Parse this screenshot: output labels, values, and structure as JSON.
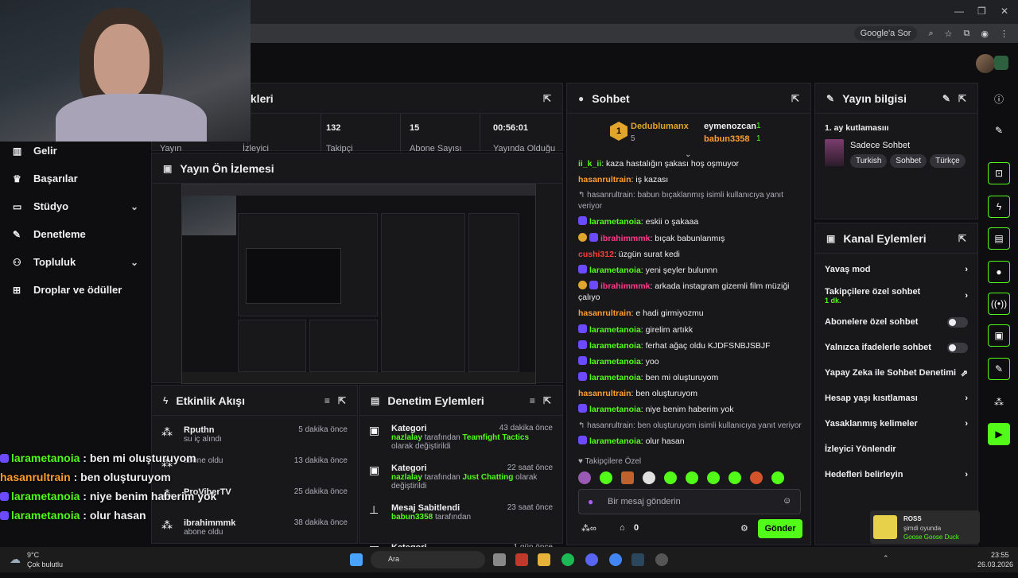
{
  "browser": {
    "search_pill": "Google'a Sor"
  },
  "nav": {
    "items": [
      {
        "label": "Gelir",
        "icon": "chart-icon"
      },
      {
        "label": "Başarılar",
        "icon": "trophy-icon"
      },
      {
        "label": "Stüdyo",
        "icon": "studio-icon"
      },
      {
        "label": "Denetleme",
        "icon": "wrench-icon"
      },
      {
        "label": "Topluluk",
        "icon": "community-icon"
      },
      {
        "label": "Droplar ve ödüller",
        "icon": "gift-icon"
      }
    ]
  },
  "stats": {
    "title_fragment": "ikleri",
    "values": [
      "132",
      "15",
      "00:56:01"
    ],
    "labels": [
      "Yayın",
      "İzleyici",
      "Takipçi",
      "Abone Sayısı",
      "Yayında Olduğu"
    ]
  },
  "preview": {
    "title": "Yayın Ön İzlemesi"
  },
  "events": {
    "title": "Etkinlik Akışı",
    "items": [
      {
        "user": "Rputhn",
        "detail": "su iç alındı",
        "time": "5 dakika önce"
      },
      {
        "user": "",
        "detail": "abone oldu",
        "time": "13 dakika önce"
      },
      {
        "user": "ProViberTV",
        "detail": "",
        "time": "25 dakika önce"
      },
      {
        "user": "ibrahimmmk",
        "detail": "abone oldu",
        "time": "38 dakika önce"
      }
    ]
  },
  "moderation": {
    "title": "Denetim Eylemleri",
    "items": [
      {
        "title": "Kategori",
        "time": "43 dakika önce",
        "who": "nazlalay",
        "mid": " tarafından ",
        "what": "Teamfight Tactics",
        "end": " olarak değiştirildi"
      },
      {
        "title": "Kategori",
        "time": "22 saat önce",
        "who": "nazlalay",
        "mid": " tarafından ",
        "what": "Just Chatting",
        "end": " olarak değiştirildi"
      },
      {
        "title": "Mesaj Sabitlendi",
        "time": "23 saat önce",
        "who": "babun3358",
        "mid": " tarafından",
        "what": "",
        "end": ""
      },
      {
        "title": "Kategori",
        "time": "1 gün önce",
        "who": "",
        "mid": "",
        "what": "",
        "end": ""
      }
    ]
  },
  "chat": {
    "title": "Sohbet",
    "top": [
      {
        "name": "Dedublumanx",
        "count": "5"
      },
      {
        "name": "eymenozcan",
        "count": "1"
      },
      {
        "name": "babun3358",
        "count": "1"
      }
    ],
    "rank": "1",
    "messages": [
      {
        "user": "ii_k_ii",
        "text": ": kaza hastalığın şakası hoş oşmuyor",
        "color": "u-g",
        "badge": ""
      },
      {
        "user": "hasanrultrain",
        "text": ": iş kazası",
        "color": "u-o",
        "badge": ""
      },
      {
        "reply": "hasanrultrain: babun bıçaklanmış isimli kullanıcıya yanıt veriyor"
      },
      {
        "user": "larametanoia",
        "text": ": eskii o şakaaa",
        "color": "u-g",
        "badge": "p"
      },
      {
        "user": "ibrahimmmk",
        "text": ": bıçak babunlanmış",
        "color": "u-p",
        "badge": "gp"
      },
      {
        "user": "cushi312",
        "text": ": üzgün surat kedi",
        "color": "u-r",
        "badge": ""
      },
      {
        "user": "larametanoia",
        "text": ": yeni şeyler bulunnn",
        "color": "u-g",
        "badge": "p"
      },
      {
        "user": "ibrahimmmk",
        "text": ": arkada instagram gizemli film müziği çalıyo",
        "color": "u-p",
        "badge": "gp"
      },
      {
        "user": "hasanrultrain",
        "text": ": e hadi girmiyozmu",
        "color": "u-o",
        "badge": ""
      },
      {
        "user": "larametanoia",
        "text": ": girelim artıkk",
        "color": "u-g",
        "badge": "p"
      },
      {
        "user": "larametanoia",
        "text": ": ferhat ağaç oldu KJDFSNBJSBJF",
        "color": "u-g",
        "badge": "p"
      },
      {
        "user": "larametanoia",
        "text": ": yoo",
        "color": "u-g",
        "badge": "p"
      },
      {
        "user": "larametanoia",
        "text": ": ben mi oluşturuyom",
        "color": "u-g",
        "badge": "p"
      },
      {
        "user": "hasanrultrain",
        "text": ": ben oluşturuyom",
        "color": "u-o",
        "badge": ""
      },
      {
        "user": "larametanoia",
        "text": ": niye benim haberim yok",
        "color": "u-g",
        "badge": "p"
      },
      {
        "reply": "hasanrultrain: ben oluşturuyom isimli kullanıcıya yanıt veriyor"
      },
      {
        "user": "larametanoia",
        "text": ": olur hasan",
        "color": "u-g",
        "badge": "p"
      }
    ],
    "followers_only": "Takipçilere Özel",
    "input_placeholder": "Bir mesaj gönderin",
    "points": "0",
    "send_label": "Gönder"
  },
  "info": {
    "title": "Yayın bilgisi",
    "stream_title": "1. ay kutlamasııı",
    "category": "Sadece Sohbet",
    "tags": [
      "Turkish",
      "Sohbet",
      "Türkçe"
    ]
  },
  "actions": {
    "title": "Kanal Eylemleri",
    "items": [
      {
        "label": "Yavaş mod",
        "sub": "",
        "kind": "chevron"
      },
      {
        "label": "Takipçilere özel sohbet",
        "sub": "1 dk.",
        "kind": "chevron"
      },
      {
        "label": "Abonelere özel sohbet",
        "sub": "",
        "kind": "toggle"
      },
      {
        "label": "Yalnızca ifadelerle sohbet",
        "sub": "",
        "kind": "toggle"
      },
      {
        "label": "Yapay Zeka ile Sohbet Denetimi",
        "sub": "",
        "kind": "external"
      },
      {
        "label": "Hesap yaşı kısıtlaması",
        "sub": "",
        "kind": "chevron"
      },
      {
        "label": "Yasaklanmış kelimeler",
        "sub": "",
        "kind": "chevron"
      },
      {
        "label": "İzleyici Yönlendir",
        "sub": "",
        "kind": "none"
      },
      {
        "label": "Hedefleri belirleyin",
        "sub": "",
        "kind": "chevron"
      }
    ]
  },
  "overlay": {
    "lines": [
      {
        "user": "larametanoia",
        "text": " : ben mi oluşturuyom",
        "color": "#53fc18"
      },
      {
        "user": "hasanrultrain",
        "text": " : ben oluşturuyom",
        "color": "#ff9d2e"
      },
      {
        "user": "larametanoia",
        "text": " : niye benim haberim yok",
        "color": "#53fc18"
      },
      {
        "user": "larametanoia",
        "text": " : olur hasan",
        "color": "#53fc18"
      }
    ]
  },
  "toast": {
    "name": "ROSS",
    "status": "şimdi oyunda",
    "game": "Goose Goose Duck"
  },
  "taskbar": {
    "temp": "9°C",
    "weather": "Çok bulutlu",
    "search": "Ara",
    "time": "23:55",
    "date": "26.03.2026"
  },
  "colors": {
    "accent": "#53fc18",
    "panel": "#18181b",
    "bg": "#0e0e10"
  }
}
